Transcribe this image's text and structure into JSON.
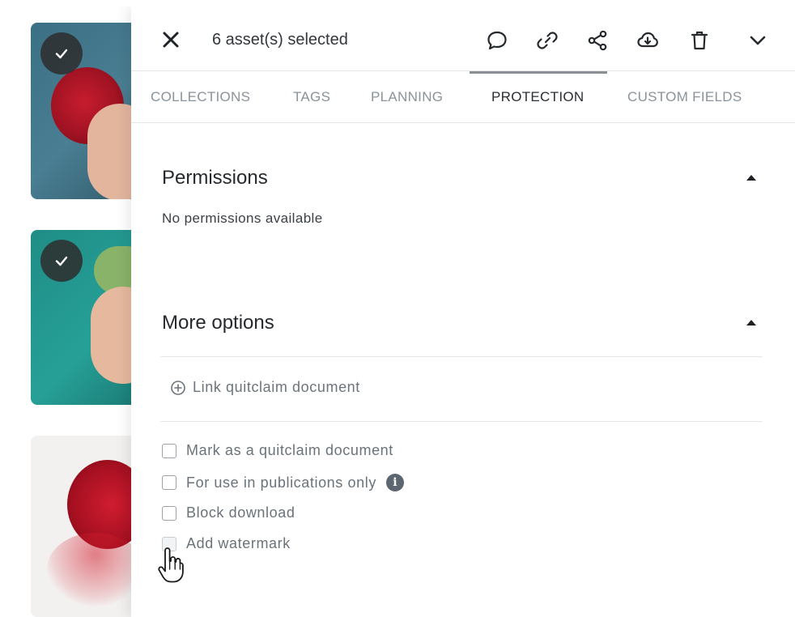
{
  "header": {
    "selected_text": "6 asset(s) selected",
    "close_icon": "close-icon",
    "toolbar_icons": [
      "comment-icon",
      "link-icon",
      "share-icon",
      "cloud-download-icon",
      "trash-icon",
      "chevron-down-icon"
    ]
  },
  "tabs": [
    {
      "label": "COLLECTIONS",
      "active": false
    },
    {
      "label": "TAGS",
      "active": false
    },
    {
      "label": "PLANNING",
      "active": false
    },
    {
      "label": "PROTECTION",
      "active": true
    },
    {
      "label": "CUSTOM FIELDS",
      "active": false
    }
  ],
  "permissions": {
    "title": "Permissions",
    "empty_text": "No permissions available"
  },
  "more_options": {
    "title": "More options",
    "link_label": "Link quitclaim document",
    "checkboxes": [
      {
        "label": "Mark as a quitclaim document",
        "checked": false
      },
      {
        "label": "For use in publications only",
        "checked": false,
        "info": "i"
      },
      {
        "label": "Block download",
        "checked": false
      },
      {
        "label": "Add watermark",
        "checked": false
      }
    ]
  },
  "thumbnails": [
    {
      "selected": true,
      "check_icon": "check-icon"
    },
    {
      "selected": true,
      "check_icon": "check-icon"
    },
    {
      "selected": false
    }
  ],
  "colors": {
    "accent": "#8a8f95",
    "text_primary": "#262a2e",
    "text_muted": "#8a939b"
  }
}
